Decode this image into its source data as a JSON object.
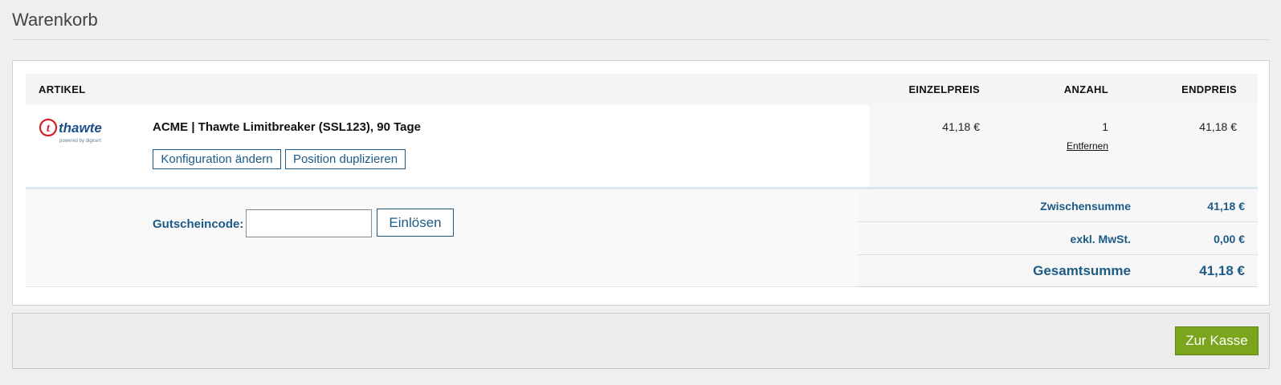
{
  "page": {
    "title": "Warenkorb"
  },
  "table": {
    "headers": {
      "artikel": "ARTIKEL",
      "einzelpreis": "EINZELPREIS",
      "anzahl": "ANZAHL",
      "endpreis": "ENDPREIS"
    },
    "items": [
      {
        "logo": {
          "icon": "thawte-logo",
          "brand": "thawte",
          "tagline": "powered by digicert"
        },
        "name": "ACME | Thawte Limitbreaker (SSL123), 90 Tage",
        "actions": {
          "configure": "Konfiguration ändern",
          "duplicate": "Position duplizieren"
        },
        "unit_price": "41,18 €",
        "quantity": "1",
        "remove_label": "Entfernen",
        "total": "41,18 €"
      }
    ]
  },
  "coupon": {
    "label": "Gutscheincode:",
    "value": "",
    "button": "Einlösen"
  },
  "totals": {
    "subtotal_label": "Zwischensumme",
    "subtotal_value": "41,18 €",
    "tax_label": "exkl. MwSt.",
    "tax_value": "0,00 €",
    "grand_label": "Gesamtsumme",
    "grand_value": "41,18 €"
  },
  "checkout": {
    "button": "Zur Kasse"
  },
  "colors": {
    "accent_blue": "#1d5a86",
    "checkout_green": "#7aa51c",
    "thawte_red": "#d6202a"
  }
}
